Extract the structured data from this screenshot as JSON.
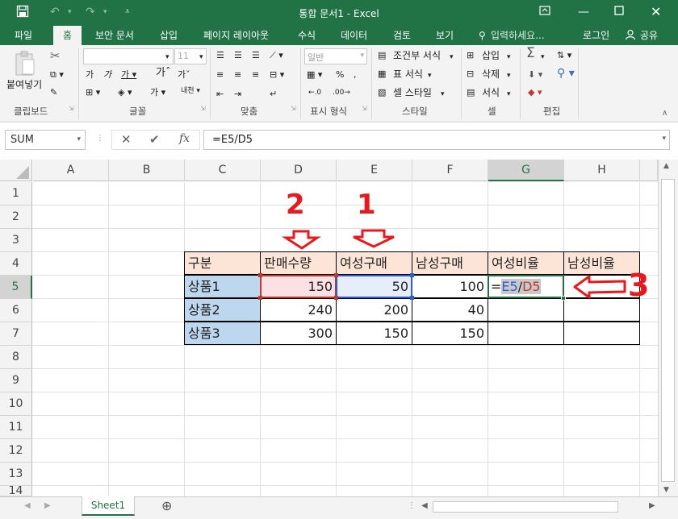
{
  "title": "통합 문서1 - Excel",
  "tabs": [
    "파일",
    "홈",
    "보안 문서",
    "삽입",
    "페이지 레이아웃",
    "수식",
    "데이터",
    "검토",
    "보기"
  ],
  "tell_me": "입력하세요...",
  "login": "로그인",
  "share": "공유",
  "ribbon": {
    "paste": "붙여넣기",
    "font_size": "11",
    "number_format": "일반",
    "cond_format": "조건부 서식",
    "table_format": "표 서식",
    "cell_style": "셀 스타일",
    "insert": "삽입",
    "delete": "삭제",
    "format": "서식",
    "groups": [
      "클립보드",
      "글꼴",
      "맞춤",
      "표시 형식",
      "스타일",
      "셀",
      "편집"
    ]
  },
  "name_box": "SUM",
  "formula": "=E5/D5",
  "columns": [
    "A",
    "B",
    "C",
    "D",
    "E",
    "F",
    "G",
    "H"
  ],
  "rows": [
    "1",
    "2",
    "3",
    "4",
    "5",
    "6",
    "7",
    "8",
    "9",
    "10",
    "11",
    "12",
    "13",
    "14"
  ],
  "table": {
    "header": [
      "구분",
      "판매수량",
      "여성구매",
      "남성구매",
      "여성비율",
      "남성비율"
    ],
    "rows": [
      [
        "상품1",
        "150",
        "50",
        "100"
      ],
      [
        "상품2",
        "240",
        "200",
        "40"
      ],
      [
        "상품3",
        "300",
        "150",
        "150"
      ]
    ],
    "edit": {
      "eq": "=",
      "e": "E5",
      "slash": "/",
      "d": "D5"
    }
  },
  "annotations": [
    "2",
    "1",
    "3"
  ],
  "sheet_tab": "Sheet1",
  "colors": {
    "excel_green": "#217346",
    "ref_blue": "#2e5bd8",
    "ref_red": "#c0392b",
    "annotation_red": "#e8191c"
  }
}
